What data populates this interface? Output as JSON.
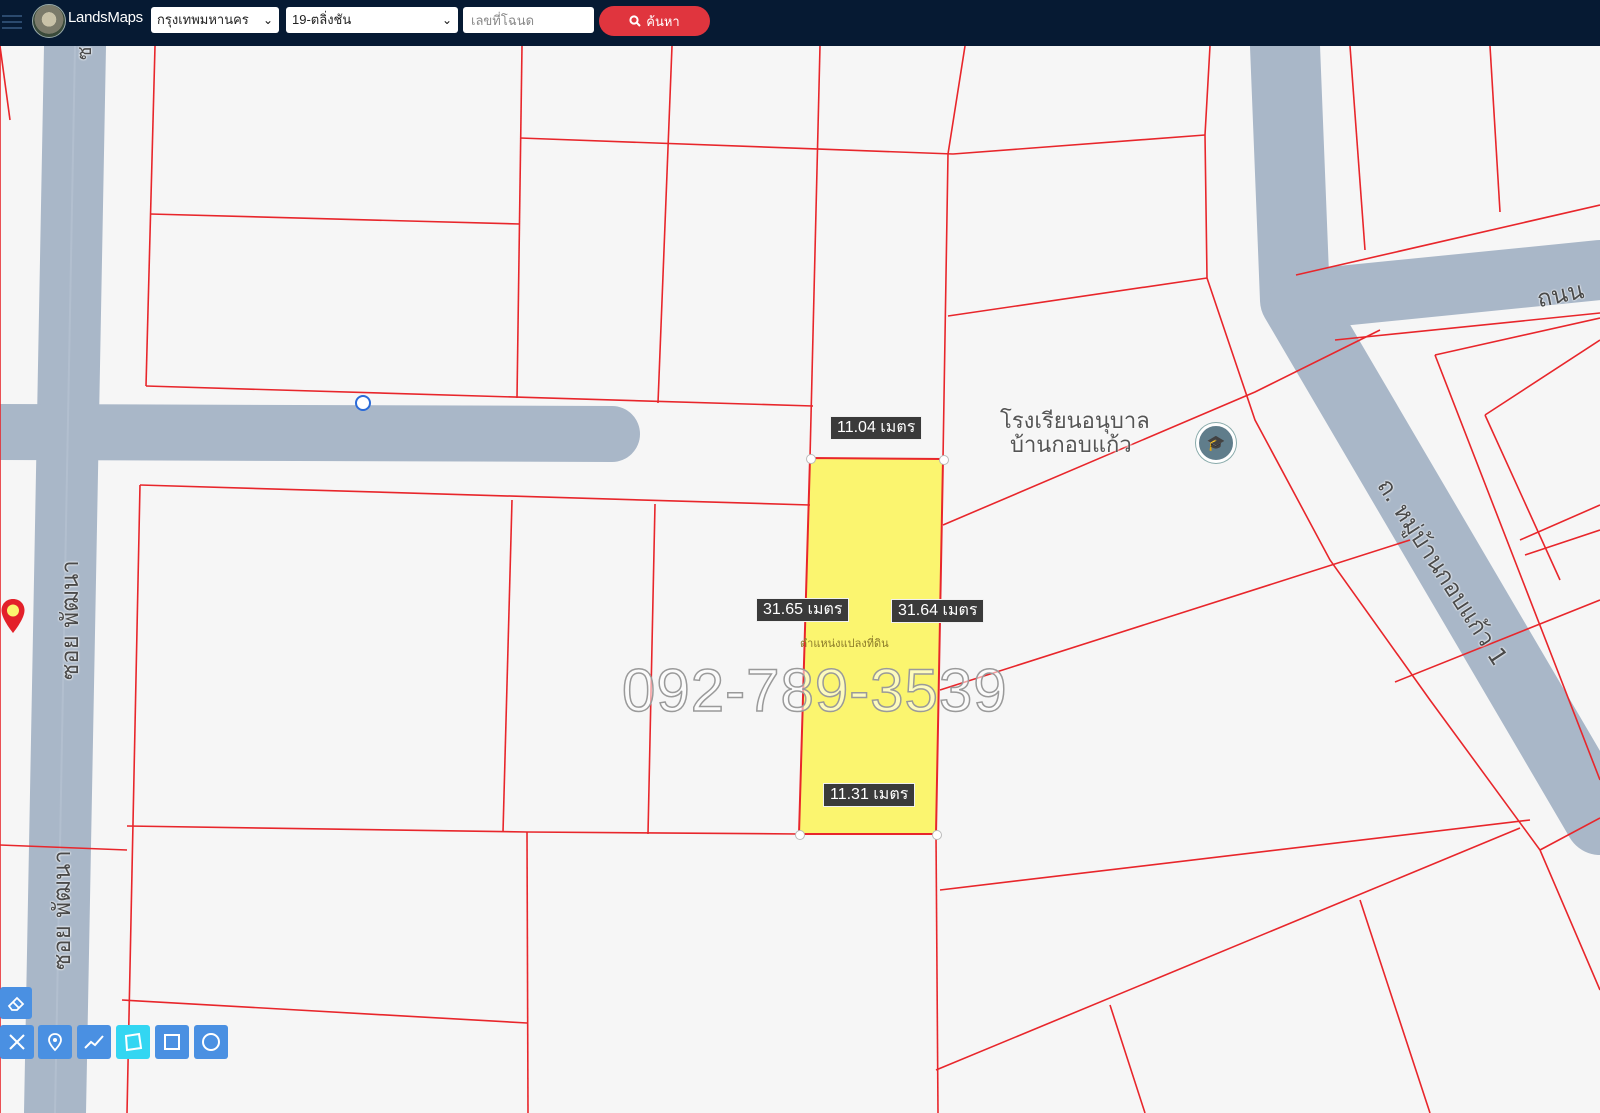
{
  "header": {
    "brand": "LandsMaps",
    "province_select": {
      "value": "กรุงเทพมหานคร"
    },
    "district_select": {
      "value": "19-ตลิ่งชัน"
    },
    "deed_input": {
      "placeholder": "เลขที่โฉนด",
      "value": ""
    },
    "search_button": {
      "label": "ค้นหา"
    }
  },
  "map": {
    "parcel": {
      "top_length": "11.04 เมตร",
      "bottom_length": "11.31 เมตร",
      "left_length": "31.65 เมตร",
      "right_length": "31.64 เมตร",
      "name": "ตำแหน่งแปลงที่ดิน",
      "fill_color": "#fbf56f",
      "boundary_color": "#e8262b"
    },
    "watermark": "092-789-3539",
    "school": {
      "line1": "โรงเรียนอนุบาล",
      "line2": "บ้านกอบแก้ว"
    },
    "roads": {
      "left_upper": "ซอย พัฒนา",
      "left_lower": "ซอย พัฒนา",
      "right": "ถ. หมู่บ้านกอบแก้ว 1",
      "top_right": "ถนน",
      "top": "ซ"
    },
    "road_color": "#a9b7c8",
    "parcel_line_color": "#e8262b"
  },
  "tools": {
    "edit": "eraser-icon",
    "items": [
      "ruler-icon",
      "pin-icon",
      "polyline-icon",
      "polygon-icon",
      "rectangle-icon",
      "circle-icon"
    ],
    "active": "polygon-icon"
  }
}
